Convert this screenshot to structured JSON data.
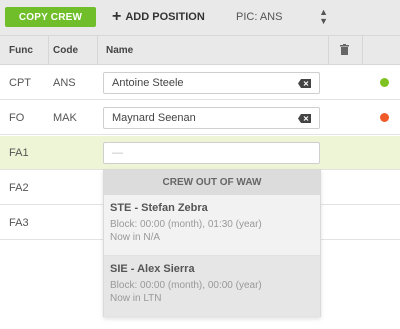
{
  "toolbar": {
    "copy_crew_label": "COPY CREW",
    "add_position_label": "ADD POSITION",
    "pic_select_value": "PIC: ANS"
  },
  "table": {
    "headers": {
      "func": "Func",
      "code": "Code",
      "name": "Name"
    },
    "rows": [
      {
        "func": "CPT",
        "code": "ANS",
        "name": "Antoine Steele",
        "status_color": "#7fc21f"
      },
      {
        "func": "FO",
        "code": "MAK",
        "name": "Maynard Seenan",
        "status_color": "#ef5a28"
      },
      {
        "func": "FA1",
        "code": "",
        "name_placeholder": "—"
      },
      {
        "func": "FA2",
        "code": ""
      },
      {
        "func": "FA3",
        "code": ""
      }
    ]
  },
  "dropdown": {
    "header": "CREW OUT OF WAW",
    "items": [
      {
        "title": "STE - Stefan Zebra",
        "block": "Block: 00:00 (month), 01:30 (year)",
        "location": "Now in N/A"
      },
      {
        "title": "SIE - Alex Sierra",
        "block": "Block: 00:00 (month), 00:00 (year)",
        "location": "Now in LTN"
      }
    ]
  },
  "colors": {
    "accent_green": "#6fbe2a",
    "active_row": "#eef5d6"
  }
}
